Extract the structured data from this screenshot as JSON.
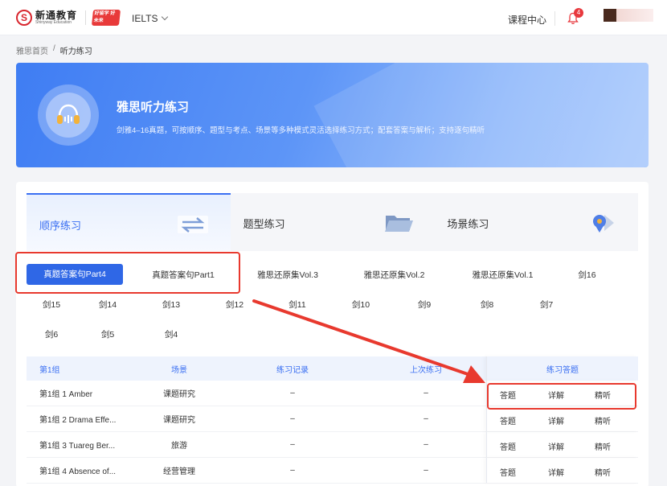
{
  "header": {
    "logo_mark": "S",
    "logo_cn": "新通教育",
    "logo_en": "Shinyway Education",
    "brand_badge": "好留学 好未来",
    "exam_select": "IELTS",
    "course_center": "课程中心",
    "notification_count": "4"
  },
  "breadcrumb": {
    "home": "雅思首页",
    "sep": "/",
    "current": "听力练习"
  },
  "banner": {
    "title": "雅思听力练习",
    "desc": "剑雅4–16真题，可按顺序、题型与考点、场景等多种模式灵活选择练习方式；配套答案与解析；支持逐句精听"
  },
  "mode_tabs": [
    {
      "label": "顺序练习",
      "active": true
    },
    {
      "label": "题型练习",
      "active": false
    },
    {
      "label": "场景练习",
      "active": false
    }
  ],
  "chips": {
    "row1": [
      "真题答案句Part4",
      "真题答案句Part1",
      "雅思还原集Vol.3",
      "雅思还原集Vol.2",
      "雅思还原集Vol.1",
      "剑16"
    ],
    "row2": [
      "剑15",
      "剑14",
      "剑13",
      "剑12",
      "剑11",
      "剑10",
      "剑9",
      "剑8",
      "剑7"
    ],
    "row3": [
      "剑6",
      "剑5",
      "剑4"
    ]
  },
  "table": {
    "headers": [
      "第1组",
      "场景",
      "练习记录",
      "上次练习",
      "练习答题"
    ],
    "rows": [
      {
        "name": "第1组 1 Amber",
        "scene": "课题研究",
        "record": "–",
        "last": "–"
      },
      {
        "name": "第1组 2 Drama Effe...",
        "scene": "课题研究",
        "record": "–",
        "last": "–"
      },
      {
        "name": "第1组 3 Tuareg Ber...",
        "scene": "旅游",
        "record": "–",
        "last": "–"
      },
      {
        "name": "第1组 4 Absence of...",
        "scene": "经营管理",
        "record": "–",
        "last": "–"
      }
    ],
    "actions": {
      "answer": "答题",
      "detail": "详解",
      "intensive": "精听"
    }
  },
  "colors": {
    "primary": "#2f67e6",
    "annotation_red": "#e8392e",
    "notification_red": "#e8383d"
  }
}
